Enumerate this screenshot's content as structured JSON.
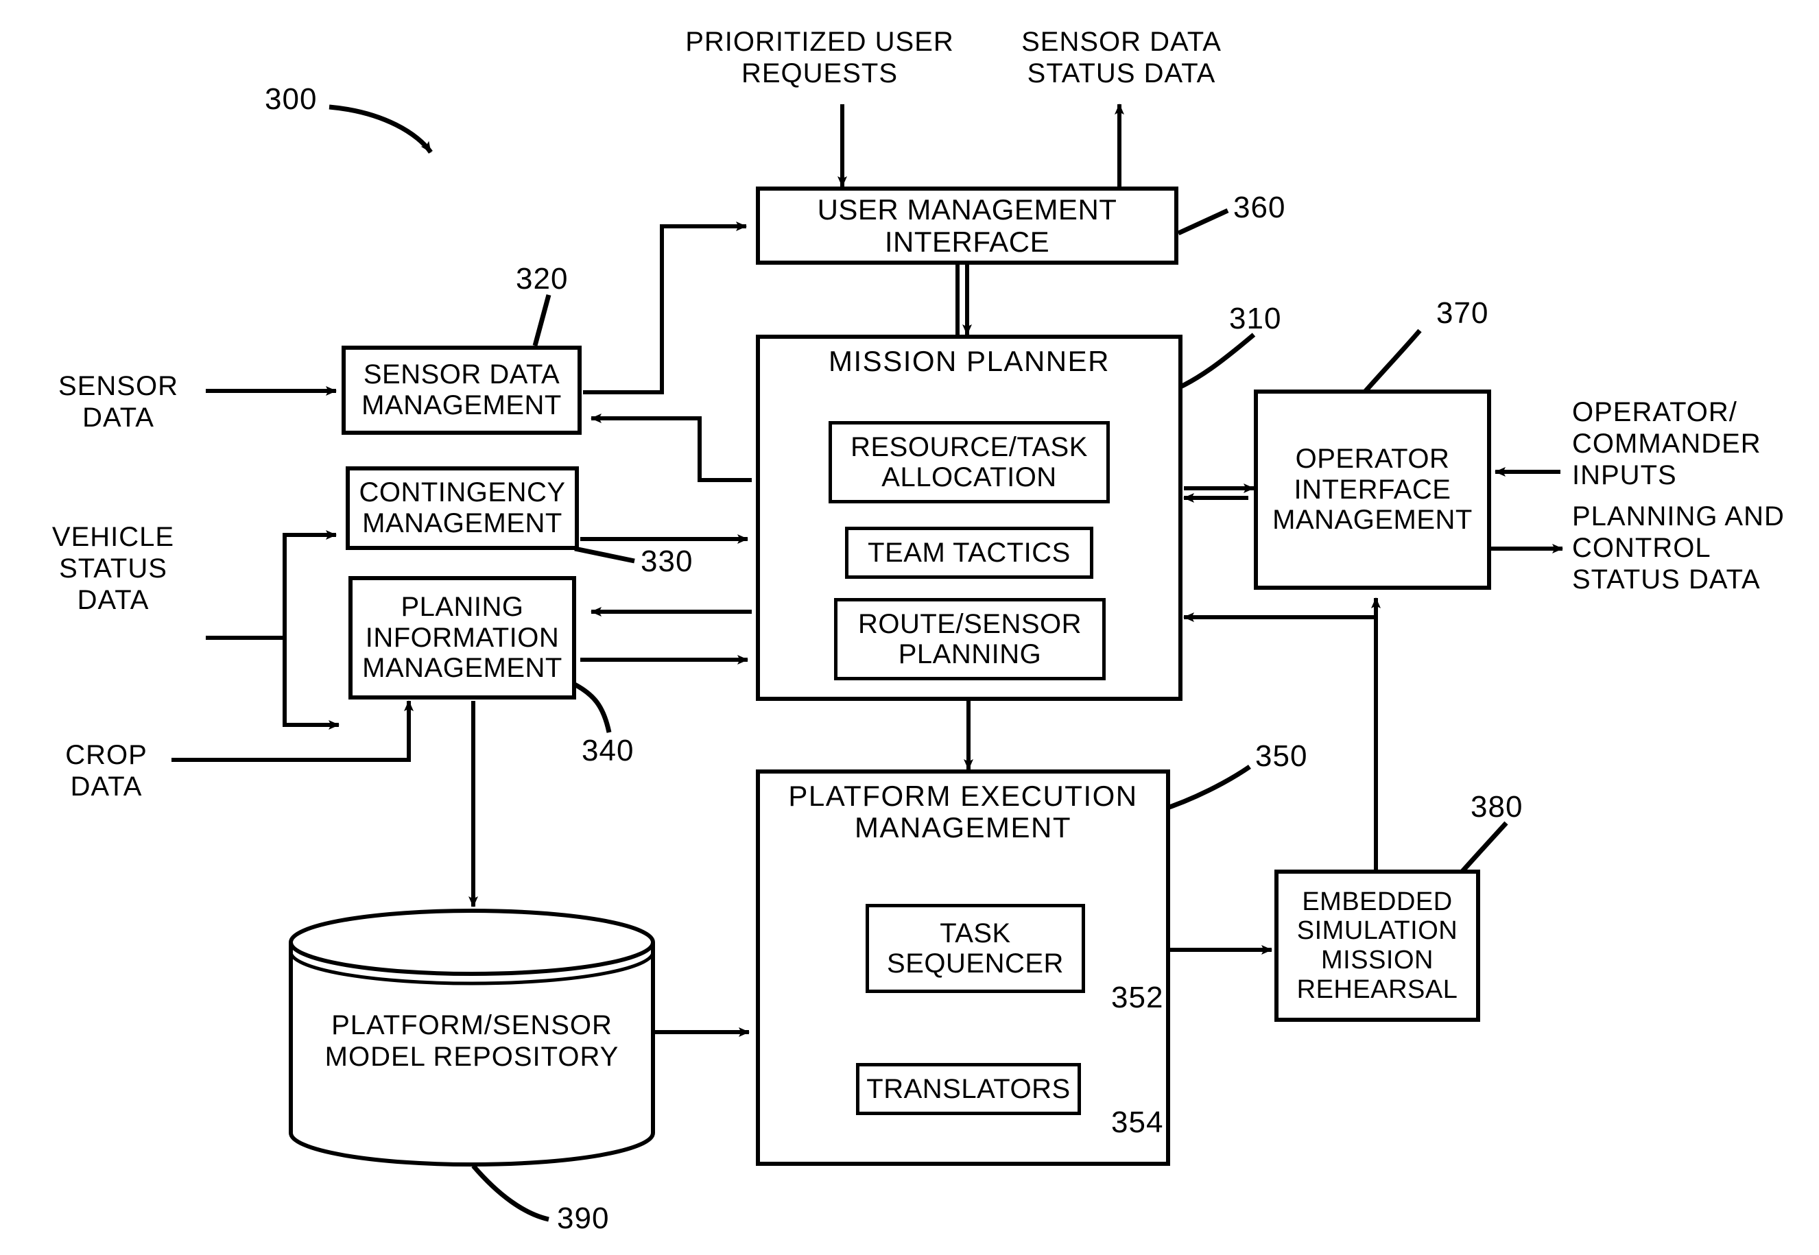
{
  "figure": {
    "ref_label": "300",
    "type": "patent-block-diagram"
  },
  "external_labels": {
    "prioritized_user_requests": "PRIORITIZED  USER\nREQUESTS",
    "sensor_data_status_data": "SENSOR  DATA\nSTATUS  DATA",
    "sensor_data": "SENSOR\nDATA",
    "vehicle_status_data": "VEHICLE\nSTATUS\nDATA",
    "crop_data": "CROP\nDATA",
    "operator_commander_inputs": "OPERATOR/\nCOMMANDER\nINPUTS",
    "planning_and_control_status_data": "PLANNING  AND\nCONTROL\nSTATUS  DATA"
  },
  "blocks": {
    "user_management_interface": {
      "label": "USER  MANAGEMENT\nINTERFACE",
      "ref": "360"
    },
    "sensor_data_management": {
      "label": "SENSOR  DATA\nMANAGEMENT",
      "ref": "320"
    },
    "contingency_management": {
      "label": "CONTINGENCY\nMANAGEMENT",
      "ref": "330"
    },
    "planing_information_management": {
      "label": "PLANING\nINFORMATION\nMANAGEMENT",
      "ref": "340"
    },
    "mission_planner": {
      "label": "MISSION  PLANNER",
      "ref": "310",
      "children": {
        "resource_task_allocation": {
          "label": "RESOURCE/TASK\nALLOCATION"
        },
        "team_tactics": {
          "label": "TEAM  TACTICS"
        },
        "route_sensor_planning": {
          "label": "ROUTE/SENSOR\nPLANNING"
        }
      }
    },
    "operator_interface_management": {
      "label": "OPERATOR\nINTERFACE\nMANAGEMENT",
      "ref": "370"
    },
    "platform_execution_management": {
      "label": "PLATFORM  EXECUTION\nMANAGEMENT",
      "ref": "350",
      "children": {
        "task_sequencer": {
          "label": "TASK\nSEQUENCER",
          "ref": "352"
        },
        "translators": {
          "label": "TRANSLATORS",
          "ref": "354"
        }
      }
    },
    "embedded_simulation_mission_rehearsal": {
      "label": "EMBEDDED\nSIMULATION\nMISSION\nREHEARSAL",
      "ref": "380"
    },
    "platform_sensor_model_repository": {
      "label": "PLATFORM/SENSOR\nMODEL  REPOSITORY",
      "ref": "390"
    }
  },
  "colors": {
    "stroke": "#000000",
    "background": "#ffffff"
  }
}
